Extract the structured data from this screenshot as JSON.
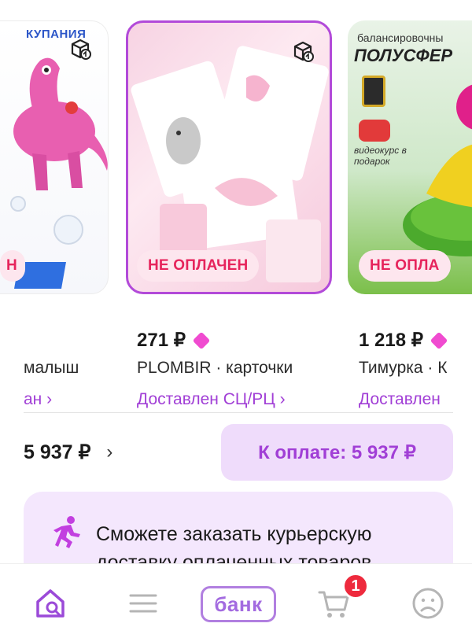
{
  "products": [
    {
      "image_text_top": "КУПАНИЯ",
      "price": "",
      "seller": "малыш",
      "status": "ан ›",
      "badge": "Н"
    },
    {
      "image_text_top": "",
      "price": "271 ₽",
      "seller": "PLOMBIR · карточки",
      "status": "Доставлен СЦ/РЦ ›",
      "badge": "НЕ ОПЛАЧЕН"
    },
    {
      "image_text_top": "балансировочны",
      "image_text_title": "ПОЛУСФЕР",
      "image_text_sub": "видеокурс в подарок",
      "price": "1 218 ₽",
      "seller": "Тимурка · К",
      "status": "Доставлен",
      "badge": "НЕ ОПЛА"
    }
  ],
  "summary": {
    "total": "5 937 ₽",
    "pay_label": "К оплате: 5 937 ₽"
  },
  "info": {
    "text": "Сможете заказать курьерскую доставку оплаченных товаров"
  },
  "tabbar": {
    "bank_label": "банк",
    "cart_count": "1"
  },
  "colors": {
    "accent": "#a13fd6",
    "badge_text": "#e6245c",
    "cart_badge": "#ee2a3d"
  }
}
